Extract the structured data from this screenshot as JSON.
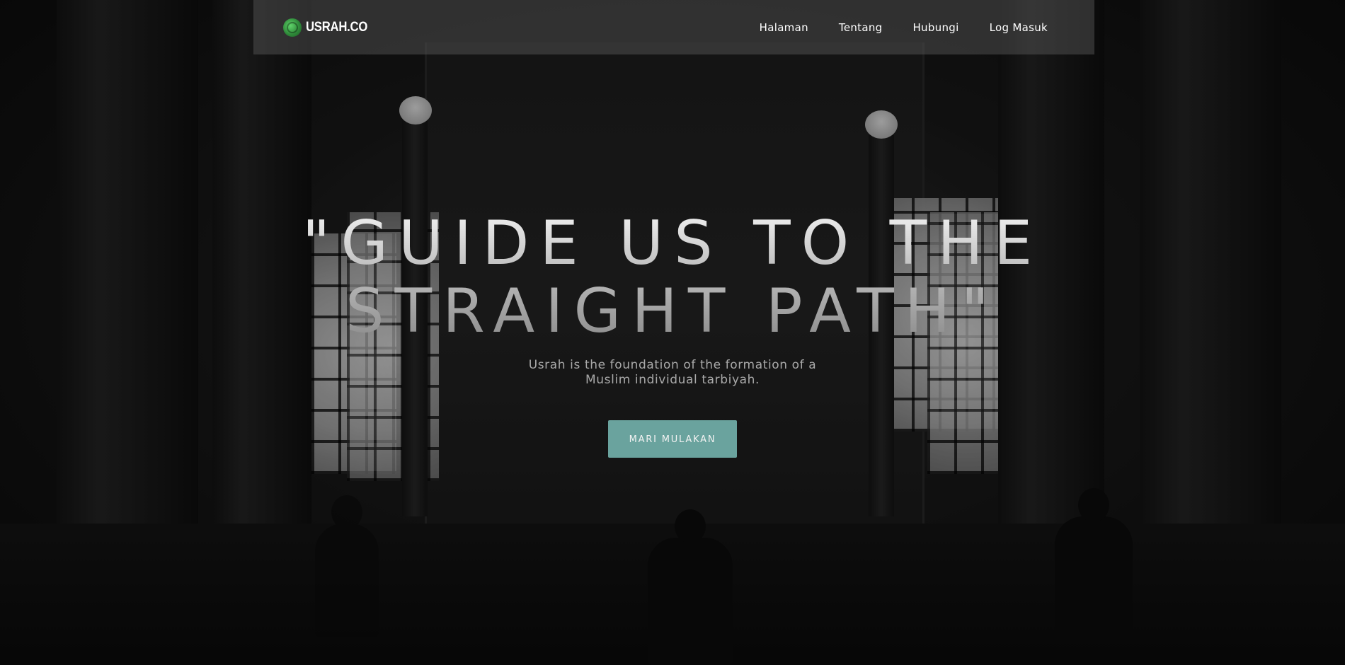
{
  "navbar": {
    "brand": {
      "logo_icon": "usrah-logo-icon",
      "name": "USRAH.CO"
    },
    "links": [
      {
        "label": "Halaman"
      },
      {
        "label": "Tentang"
      },
      {
        "label": "Hubungi"
      },
      {
        "label": "Log Masuk"
      }
    ]
  },
  "hero": {
    "headline": "\"GUIDE US TO THE STRAIGHT PATH\"",
    "subtitle": "Usrah is the foundation of the formation of a Muslim individual tarbiyah.",
    "cta_label": "MARI MULAKAN"
  },
  "colors": {
    "accent": "#6aa39e",
    "navbar_bg": "rgba(90,90,90,0.45)",
    "logo_green": "#2f8a3a"
  }
}
